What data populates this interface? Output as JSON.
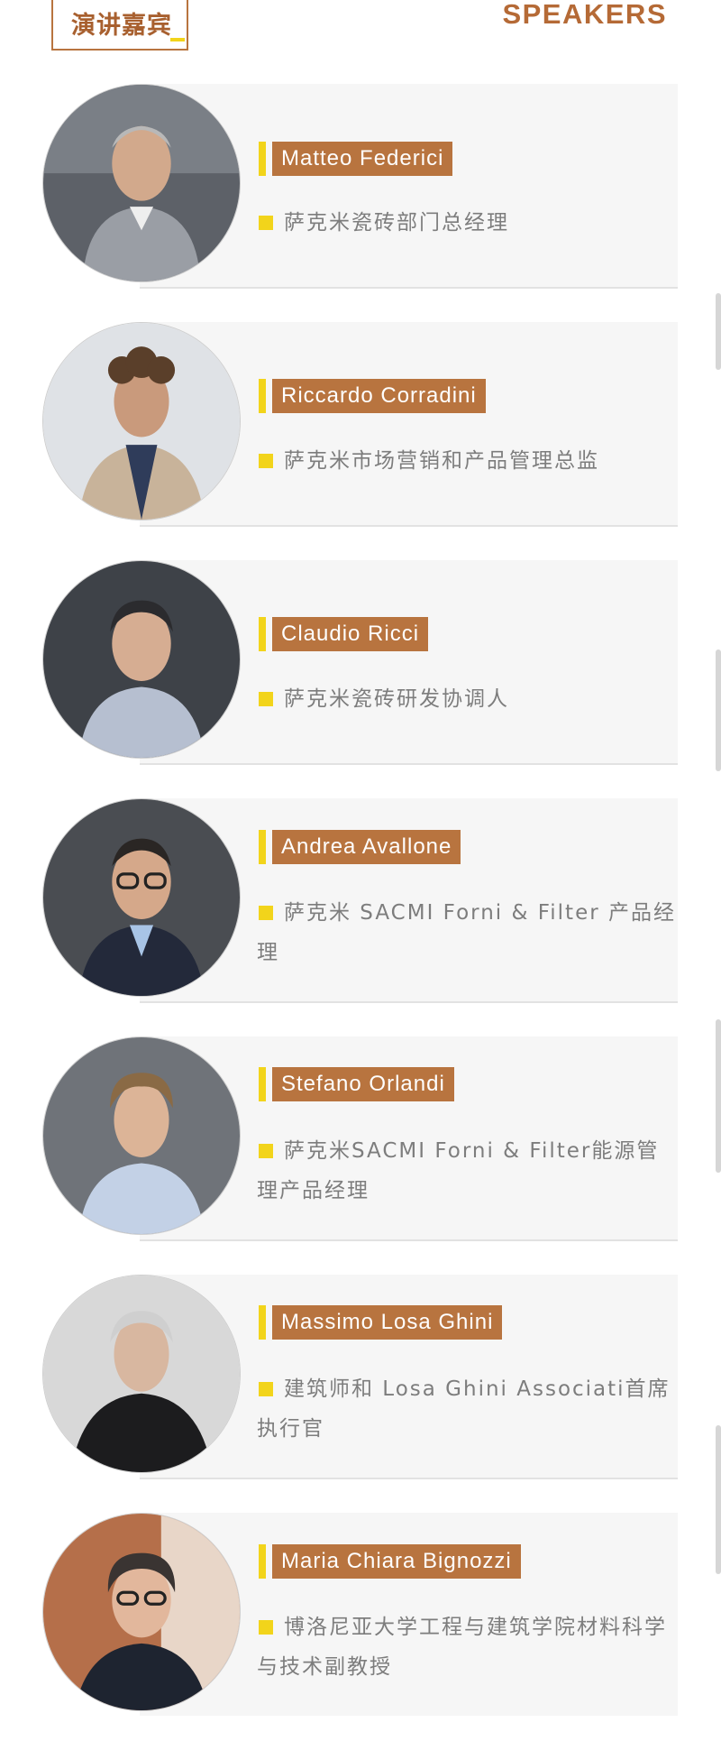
{
  "header": {
    "title_cn": "演讲嘉宾",
    "title_en": "SPEAKERS"
  },
  "colors": {
    "accent_brown": "#b8743f",
    "accent_yellow": "#f2d41b",
    "card_bg": "#f6f6f6",
    "role_text": "#7d7d7d"
  },
  "speakers": [
    {
      "name": "Matteo Federici",
      "role": "萨克米瓷砖部门总经理"
    },
    {
      "name": "Riccardo Corradini",
      "role": "萨克米市场营销和产品管理总监"
    },
    {
      "name": "Claudio Ricci",
      "role": "萨克米瓷砖研发协调人"
    },
    {
      "name": "Andrea Avallone",
      "role": "萨克米 SACMI Forni & Filter 产品经理"
    },
    {
      "name": "Stefano Orlandi",
      "role": "萨克米SACMI Forni & Filter能源管理产品经理"
    },
    {
      "name": "Massimo Losa Ghini",
      "role": "建筑师和 Losa Ghini Associati首席执行官"
    },
    {
      "name": "Maria Chiara Bignozzi",
      "role": "博洛尼亚大学工程与建筑学院材料科学与技术副教授"
    }
  ],
  "icons": {
    "avatar": "person-portrait-icon",
    "bullet": "yellow-square-bullet-icon"
  }
}
